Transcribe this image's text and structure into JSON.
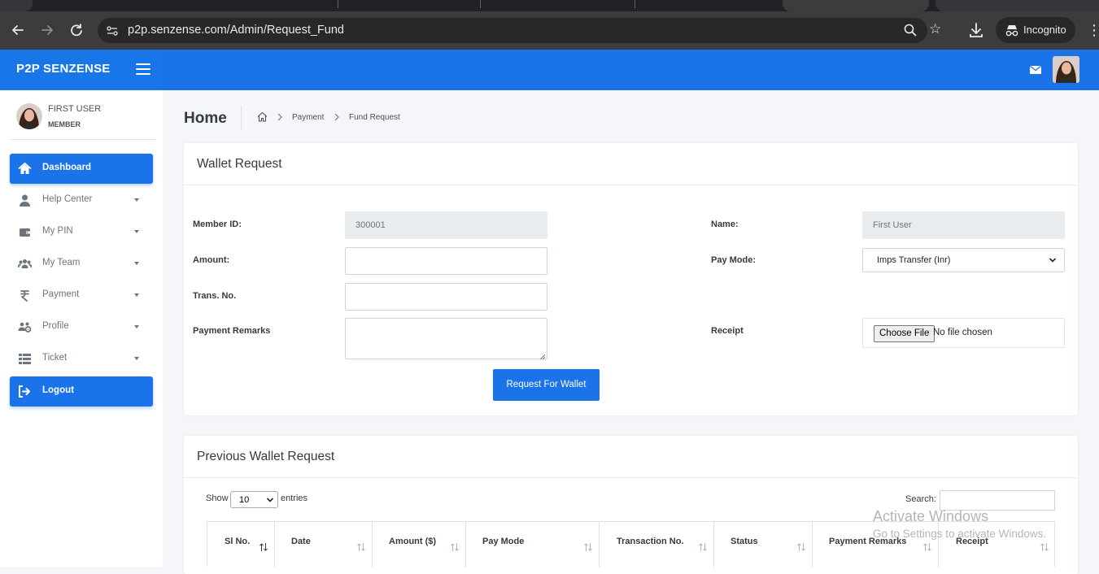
{
  "browser": {
    "url": "p2p.senzense.com/Admin/Request_Fund",
    "profile_label": "Incognito"
  },
  "header": {
    "brand": "P2P SENZENSE",
    "accent_color": "#1a73e8"
  },
  "sidebar": {
    "user_name": "FIRST USER",
    "user_role": "MEMBER",
    "items": [
      {
        "label": "Dashboard",
        "icon": "home-icon",
        "active": true
      },
      {
        "label": "Help Center",
        "icon": "user-icon",
        "dropdown": true
      },
      {
        "label": "My PIN",
        "icon": "wallet-icon",
        "dropdown": true
      },
      {
        "label": "My Team",
        "icon": "team-icon",
        "dropdown": true
      },
      {
        "label": "Payment",
        "icon": "rupee-icon",
        "dropdown": true
      },
      {
        "label": "Profile",
        "icon": "users-cog-icon",
        "dropdown": true
      },
      {
        "label": "Ticket",
        "icon": "table-icon",
        "dropdown": true
      },
      {
        "label": "Logout",
        "icon": "sign-out-icon",
        "active": true
      }
    ]
  },
  "page": {
    "title": "Home",
    "breadcrumb": [
      "Payment",
      "Fund Request"
    ]
  },
  "wallet_request": {
    "title": "Wallet Request",
    "member_id_label": "Member ID:",
    "member_id_value": "300001",
    "name_label": "Name:",
    "name_value": "First User",
    "amount_label": "Amount:",
    "amount_value": "",
    "pay_mode_label": "Pay Mode:",
    "pay_mode_value": "Imps Transfer (Inr)",
    "trans_no_label": "Trans. No.",
    "trans_no_value": "",
    "remarks_label": "Payment Remarks",
    "remarks_value": "",
    "receipt_label": "Receipt",
    "choose_file_label": "Choose File",
    "no_file_text": "No file chosen",
    "submit_label": "Request For Wallet"
  },
  "previous_requests": {
    "title": "Previous Wallet Request",
    "show_label": "Show",
    "page_size": "10",
    "entries_label": "entries",
    "search_label": "Search:",
    "columns": [
      "Sl No.",
      "Date",
      "Amount ($)",
      "Pay Mode",
      "Transaction No.",
      "Status",
      "Payment Remarks",
      "Receipt"
    ]
  },
  "os_watermark": {
    "line1": "Activate Windows",
    "line2": "Go to Settings to activate Windows."
  }
}
